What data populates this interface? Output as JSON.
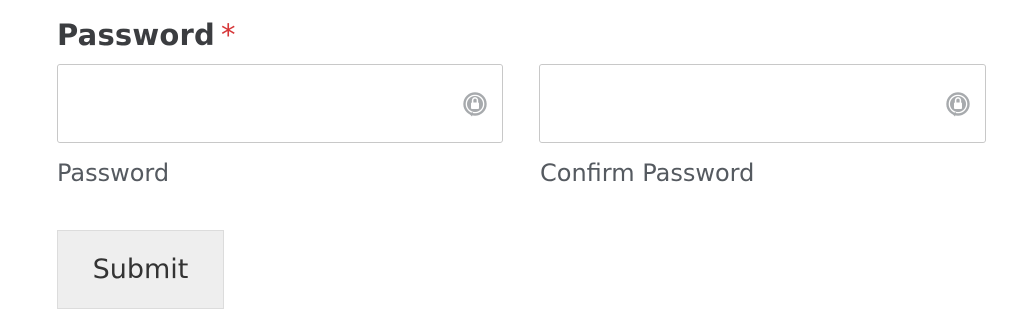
{
  "form": {
    "field_title": "Password",
    "required_mark": "*",
    "password_input": {
      "value": "",
      "placeholder": ""
    },
    "password_sublabel": "Password",
    "confirm_input": {
      "value": "",
      "placeholder": ""
    },
    "confirm_sublabel": "Confirm Password",
    "submit_label": "Submit"
  },
  "icons": {
    "password_manager": "password-manager-lock-icon"
  },
  "colors": {
    "required": "#d63638",
    "title": "#3b3d40",
    "border": "#c8c8c8",
    "button_bg": "#eeeeee",
    "icon": "#a7aaad"
  }
}
